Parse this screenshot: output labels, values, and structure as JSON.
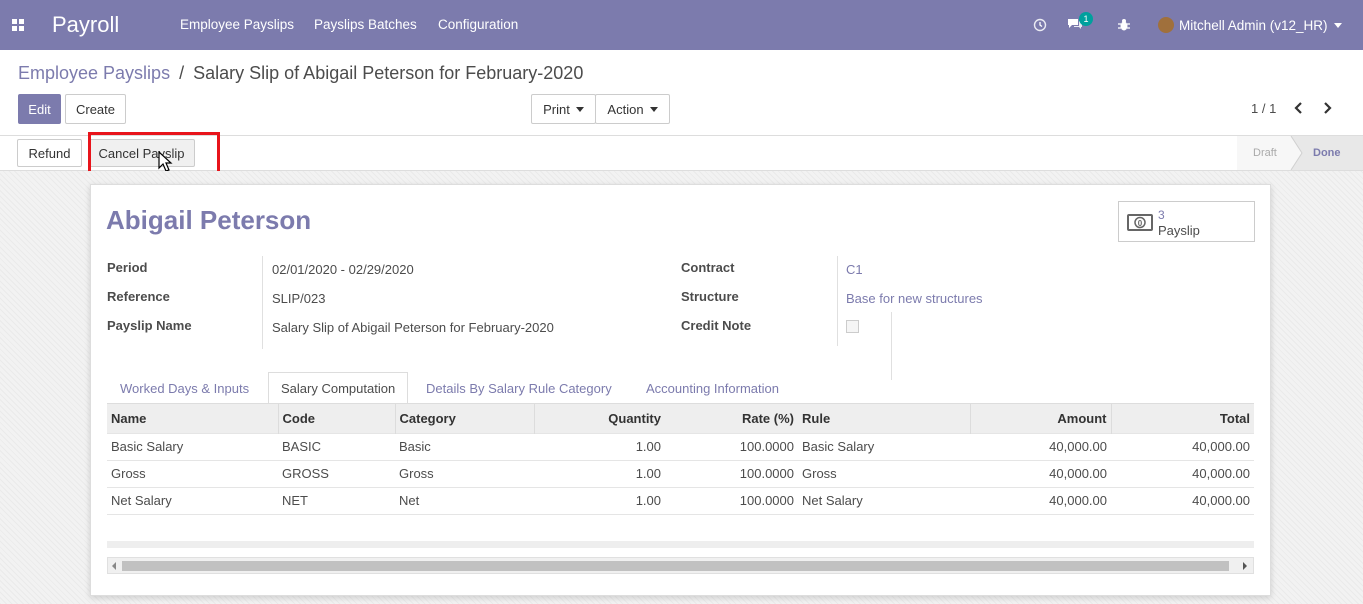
{
  "navbar": {
    "app_name": "Payroll",
    "menu": [
      "Employee Payslips",
      "Payslips Batches",
      "Configuration"
    ],
    "messages_count": "1",
    "user": "Mitchell Admin (v12_HR)",
    "color": "#7c7bad"
  },
  "breadcrumb": {
    "parent": "Employee Payslips",
    "separator": "/",
    "current": "Salary Slip of Abigail Peterson for February-2020"
  },
  "toolbar": {
    "edit_label": "Edit",
    "create_label": "Create",
    "print_label": "Print",
    "action_label": "Action"
  },
  "pager": {
    "value": "1 / 1"
  },
  "statusbar": {
    "refund_label": "Refund",
    "cancel_label": "Cancel Payslip",
    "steps": [
      "Draft",
      "Done"
    ],
    "current_step": "Done"
  },
  "smart_button": {
    "value": "3",
    "label": "Payslip",
    "icon": "money-icon"
  },
  "employee": {
    "name": "Abigail Peterson"
  },
  "fields_left": [
    {
      "label": "Period",
      "value": "02/01/2020 - 02/29/2020"
    },
    {
      "label": "Reference",
      "value": "SLIP/023"
    },
    {
      "label": "Payslip Name",
      "value": "Salary Slip of Abigail Peterson for February-2020"
    }
  ],
  "fields_right": [
    {
      "label": "Contract",
      "value": "C1"
    },
    {
      "label": "Structure",
      "value": "Base for new structures"
    },
    {
      "label": "Credit Note",
      "value": ""
    }
  ],
  "tabs": [
    "Worked Days & Inputs",
    "Salary Computation",
    "Details By Salary Rule Category",
    "Accounting Information"
  ],
  "active_tab": "Salary Computation",
  "table": {
    "headers": [
      "Name",
      "Code",
      "Category",
      "Quantity",
      "Rate (%)",
      "Rule",
      "Amount",
      "Total"
    ],
    "rows": [
      [
        "Basic Salary",
        "BASIC",
        "Basic",
        "1.00",
        "100.0000",
        "Basic Salary",
        "40,000.00",
        "40,000.00"
      ],
      [
        "Gross",
        "GROSS",
        "Gross",
        "1.00",
        "100.0000",
        "Gross",
        "40,000.00",
        "40,000.00"
      ],
      [
        "Net Salary",
        "NET",
        "Net",
        "1.00",
        "100.0000",
        "Net Salary",
        "40,000.00",
        "40,000.00"
      ]
    ]
  }
}
